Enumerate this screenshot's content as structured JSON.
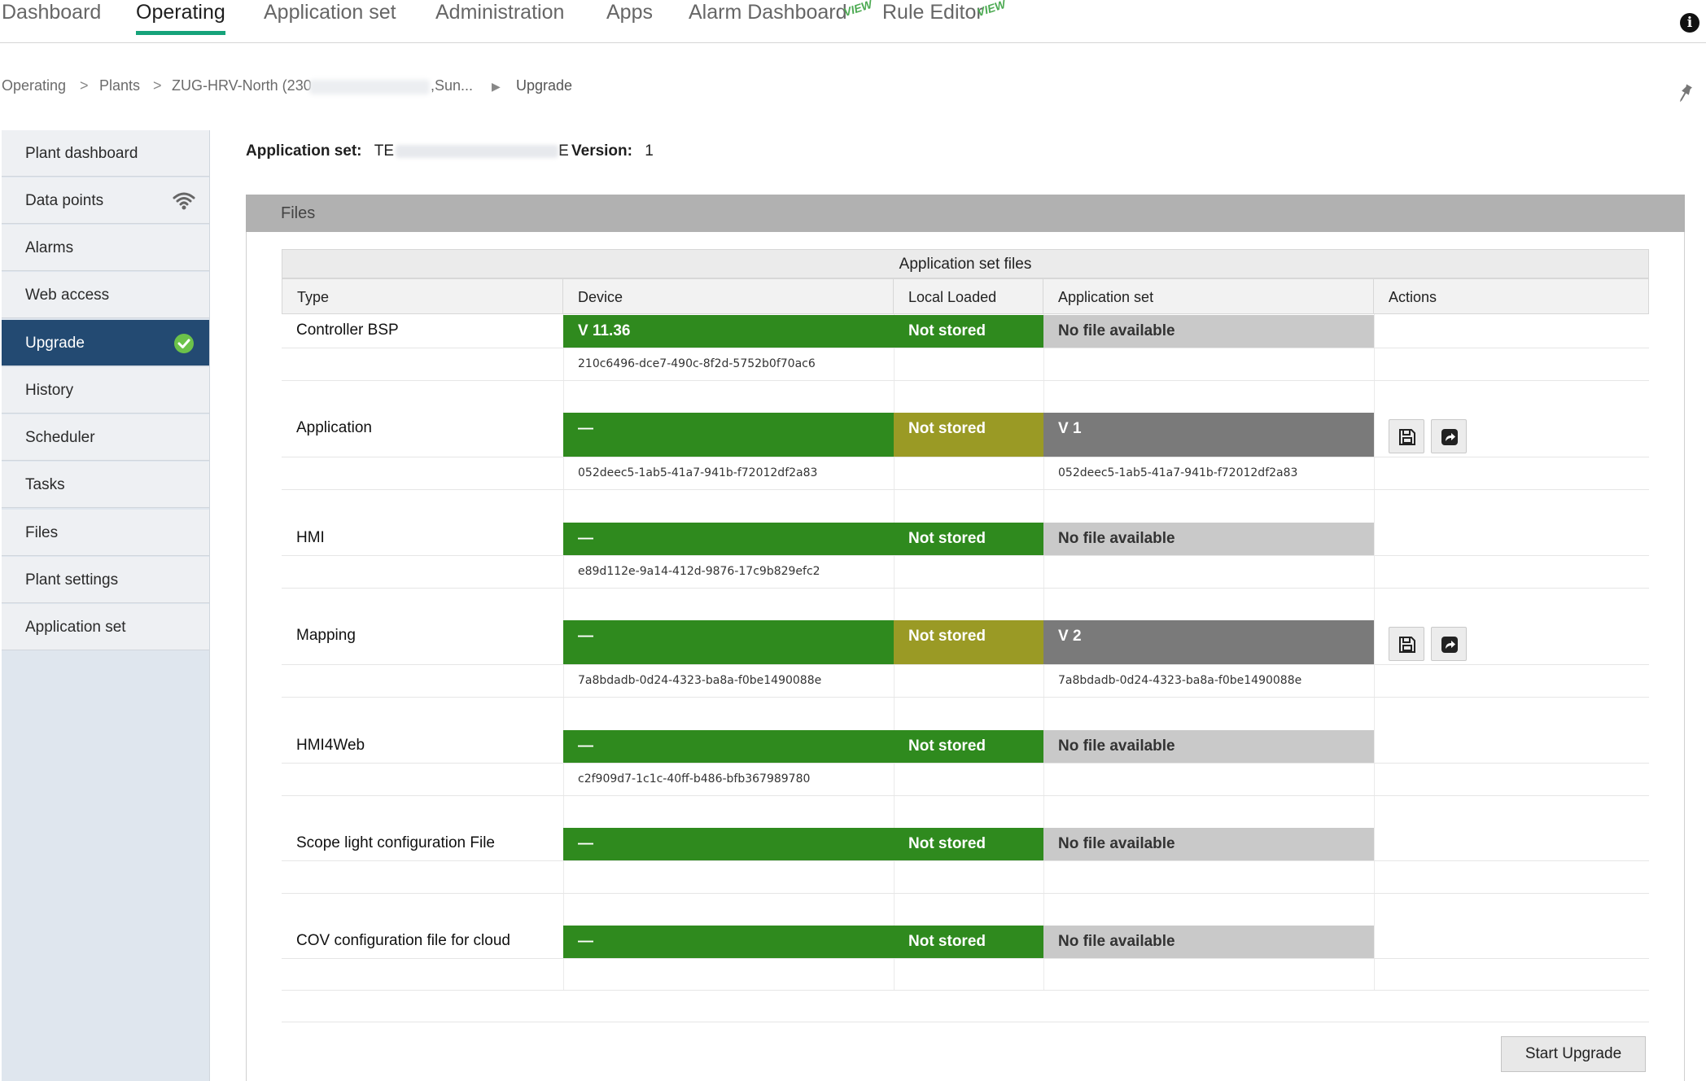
{
  "nav": {
    "tabs": [
      "Dashboard",
      "Operating",
      "Application set",
      "Administration",
      "Apps",
      "Alarm Dashboard",
      "Rule Editor"
    ],
    "active_tab": "Operating",
    "badges": {
      "alarm": "VIEW",
      "rule": "VIEW"
    }
  },
  "breadcrumb": {
    "items": [
      "Operating",
      "Plants",
      "ZUG-HRV-North (230",
      ",Sun...",
      "Upgrade"
    ],
    "separators": [
      ">",
      ">",
      "▶"
    ]
  },
  "sidebar": {
    "items": [
      "Plant dashboard",
      "Data points",
      "Alarms",
      "Web access",
      "Upgrade",
      "History",
      "Scheduler",
      "Tasks",
      "Files",
      "Plant settings",
      "Application set"
    ],
    "active": "Upgrade",
    "icons": {
      "data_points": "wifi-icon",
      "upgrade": "check-circle-icon"
    }
  },
  "meta": {
    "app_set_label": "Application set:",
    "app_set_value_start": "TE",
    "app_set_value_end": "E",
    "version_label": "Version:",
    "version_value": "1"
  },
  "panel": {
    "title": "Files",
    "caption": "Application set files",
    "columns": [
      "Type",
      "Device",
      "Local Loaded",
      "Application set",
      "Actions"
    ]
  },
  "rows": [
    {
      "type": "Controller BSP",
      "device": "V 11.36",
      "device_id": "210c6496-dce7-490c-8f2d-5752b0f70ac6",
      "local": "Not stored",
      "local_style": "green",
      "appset": "No file available",
      "appset_style": "grey",
      "appset_id": "",
      "actions": false
    },
    {
      "type": "Application",
      "device": "—",
      "device_id": "052deec5-1ab5-41a7-941b-f72012df2a83",
      "local": "Not stored",
      "local_style": "olive",
      "appset": "V 1",
      "appset_style": "darkgrey",
      "appset_id": "052deec5-1ab5-41a7-941b-f72012df2a83",
      "actions": true
    },
    {
      "type": "HMI",
      "device": "—",
      "device_id": "e89d112e-9a14-412d-9876-17c9b829efc2",
      "local": "Not stored",
      "local_style": "green",
      "appset": "No file available",
      "appset_style": "grey",
      "appset_id": "",
      "actions": false
    },
    {
      "type": "Mapping",
      "device": "—",
      "device_id": "7a8bdadb-0d24-4323-ba8a-f0be1490088e",
      "local": "Not stored",
      "local_style": "olive",
      "appset": "V 2",
      "appset_style": "darkgrey",
      "appset_id": "7a8bdadb-0d24-4323-ba8a-f0be1490088e",
      "actions": true
    },
    {
      "type": "HMI4Web",
      "device": "—",
      "device_id": "c2f909d7-1c1c-40ff-b486-bfb367989780",
      "local": "Not stored",
      "local_style": "green",
      "appset": "No file available",
      "appset_style": "grey",
      "appset_id": "",
      "actions": false
    },
    {
      "type": "Scope light configuration File",
      "device": "—",
      "device_id": "",
      "local": "Not stored",
      "local_style": "green",
      "appset": "No file available",
      "appset_style": "grey",
      "appset_id": "",
      "actions": false
    },
    {
      "type": "COV configuration file for cloud",
      "device": "—",
      "device_id": "",
      "local": "Not stored",
      "local_style": "green",
      "appset": "No file available",
      "appset_style": "grey",
      "appset_id": "",
      "actions": false
    }
  ],
  "action_icons": [
    "save-icon",
    "share-icon"
  ],
  "start_upgrade_label": "Start Upgrade",
  "colors": {
    "accent": "#16a37a",
    "sidebar_active": "#234a72",
    "green_cell": "#2f8a1e",
    "olive_cell": "#9a9a25",
    "grey_cell": "#c9c9c9",
    "darkgrey_cell": "#7a7a7a"
  }
}
